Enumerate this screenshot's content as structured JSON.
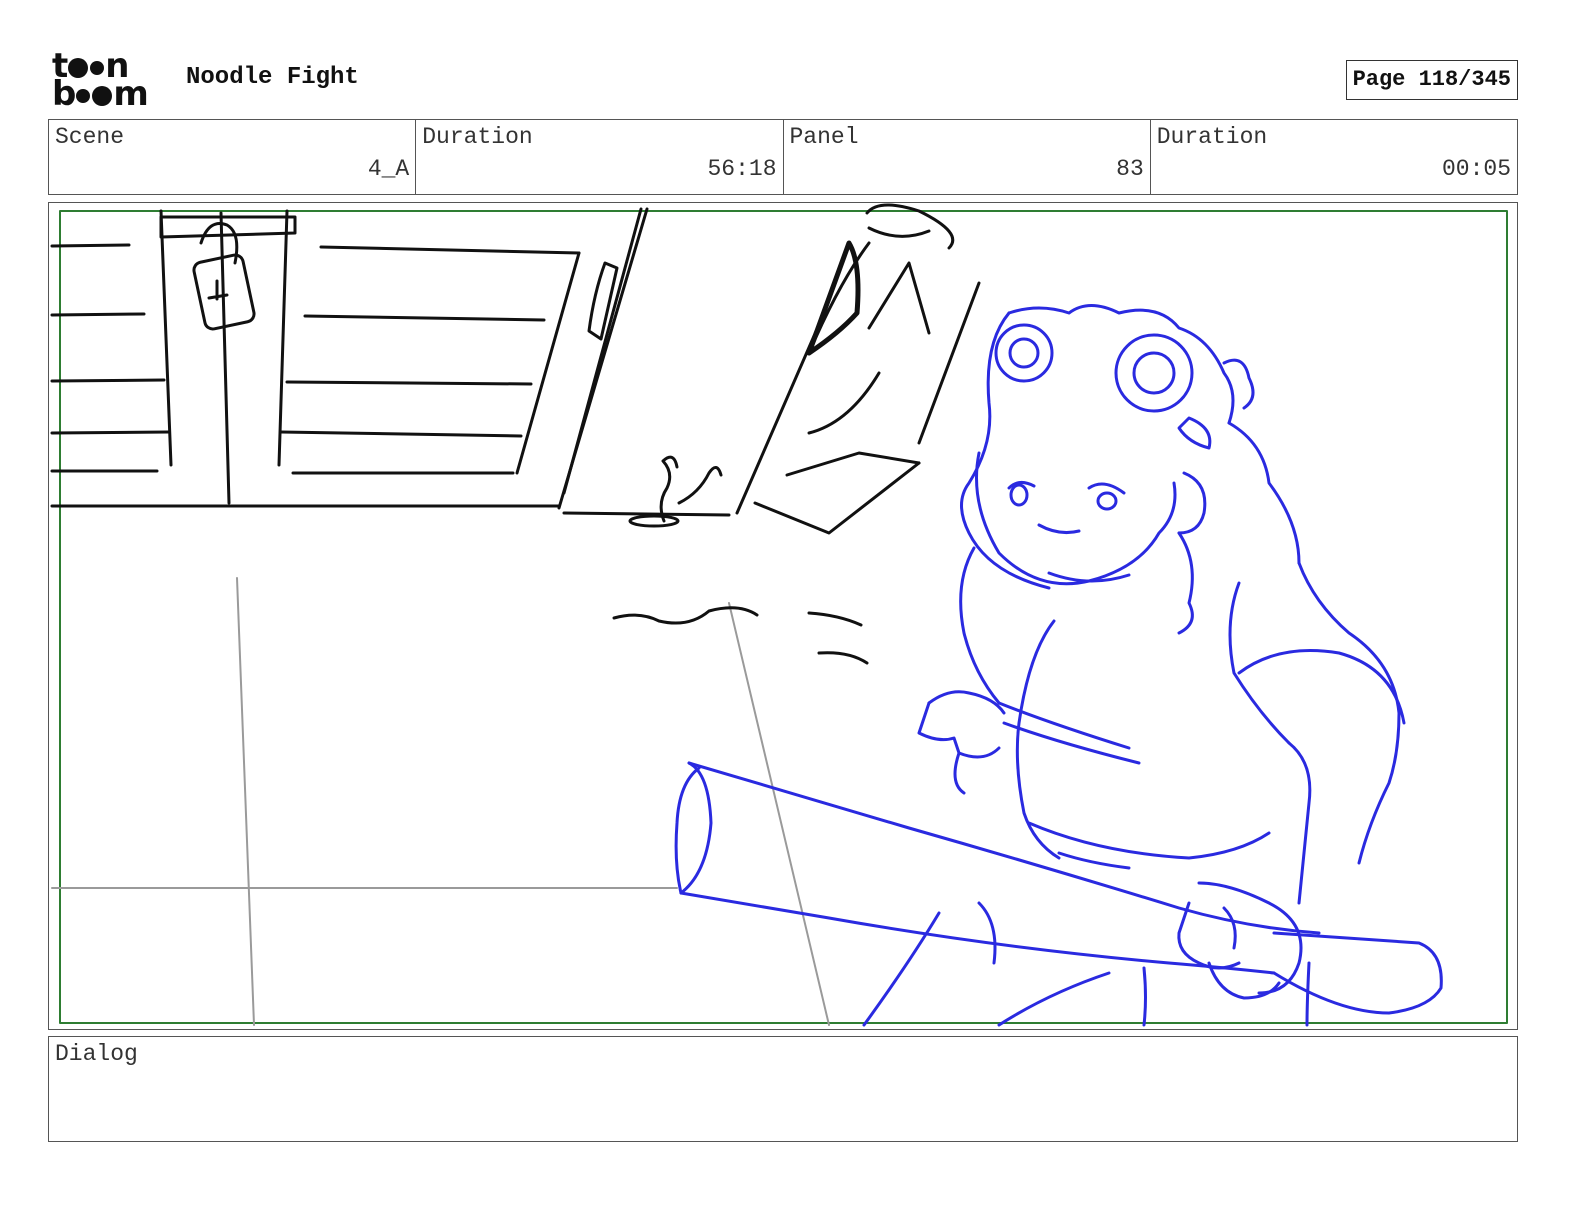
{
  "header": {
    "logo": "toon boom",
    "project_title": "Noodle Fight",
    "page_label": "Page 118/345"
  },
  "info": {
    "scene_label": "Scene",
    "scene_value": "4_A",
    "duration_label": "Duration",
    "duration_value": "56:18",
    "panel_label": "Panel",
    "panel_value": "83",
    "panel_duration_label": "Duration",
    "panel_duration_value": "00:05"
  },
  "dialog": {
    "label": "Dialog",
    "text": ""
  },
  "colors": {
    "sketch_black": "#111111",
    "sketch_blue": "#2a2ae0",
    "guide_grey": "#9a9a9a",
    "frame_green": "#2e7d32"
  }
}
